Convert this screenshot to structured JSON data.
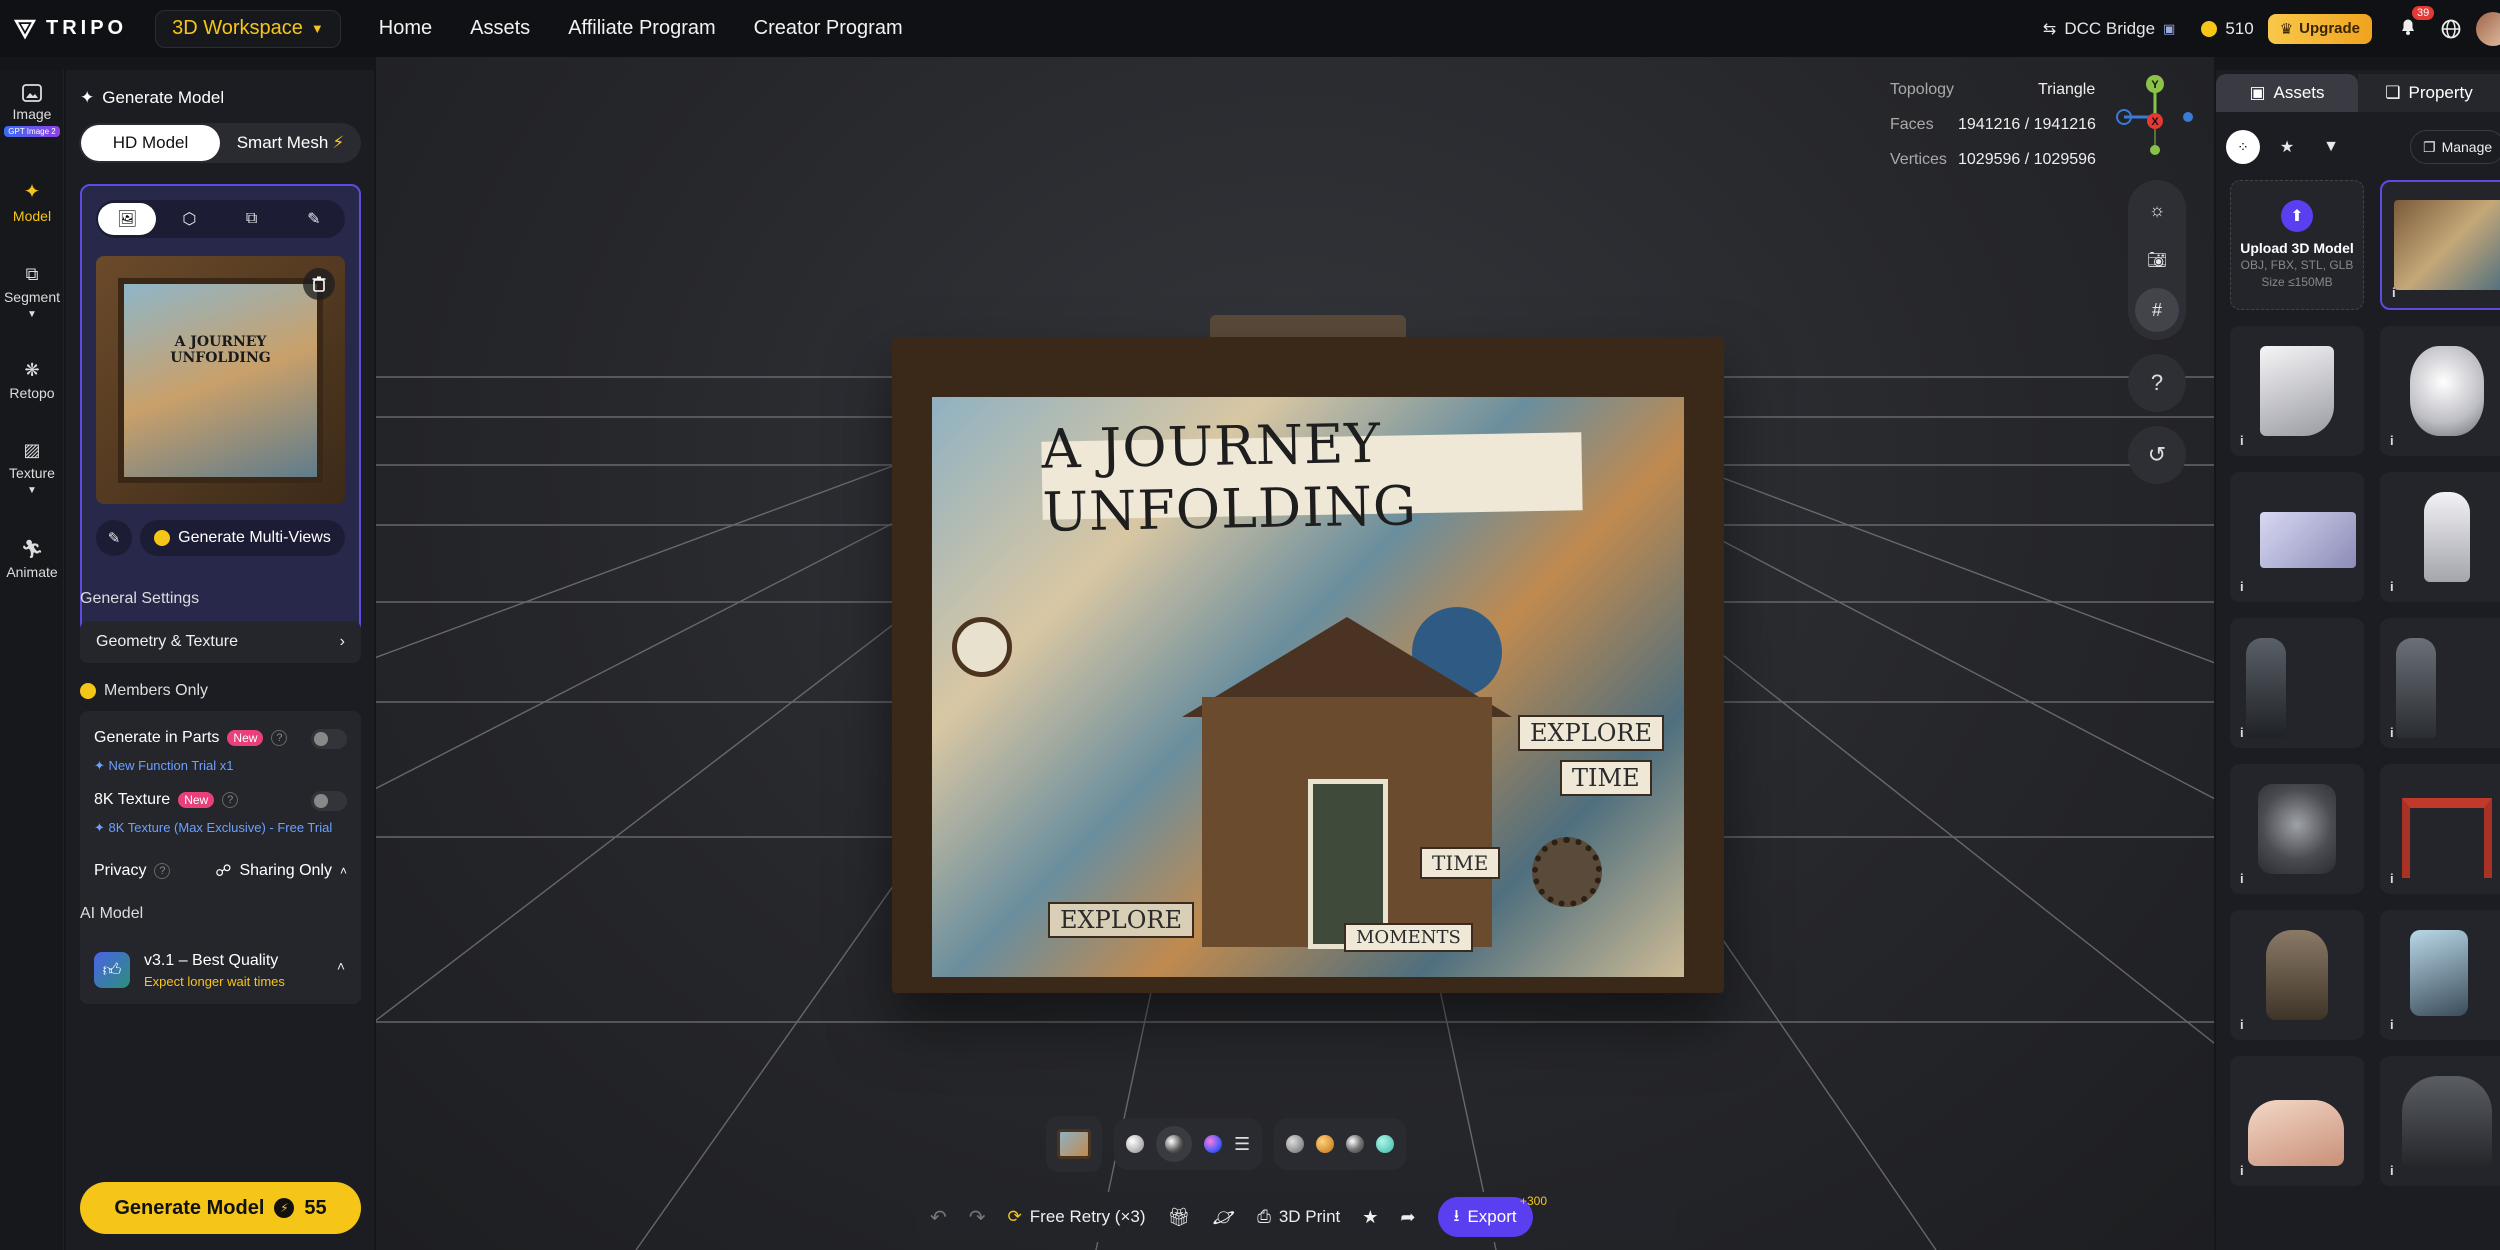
{
  "app": {
    "brand": "TRIPO",
    "workspace": "3D Workspace"
  },
  "nav": {
    "links": [
      "Home",
      "Assets",
      "Affiliate Program",
      "Creator Program"
    ]
  },
  "topright": {
    "dcc_bridge": "DCC Bridge",
    "credits": "510",
    "upgrade": "Upgrade",
    "notifications": "39"
  },
  "rail": {
    "items": [
      {
        "label": "Image",
        "badge": "GPT Image 2"
      },
      {
        "label": "Model"
      },
      {
        "label": "Segment"
      },
      {
        "label": "Retopo"
      },
      {
        "label": "Texture"
      },
      {
        "label": "Animate"
      }
    ]
  },
  "panel": {
    "title": "Generate Model",
    "mode_hd": "HD Model",
    "mode_smart": "Smart Mesh",
    "thumb_caption": "A JOURNEY UNFOLDING",
    "multiview": "Generate Multi-Views",
    "general_settings": "General Settings",
    "geometry_texture": "Geometry & Texture",
    "members_only": "Members Only",
    "parts_label": "Generate in Parts",
    "parts_new": "New",
    "parts_trial": "New Function Trial x1",
    "texture8k_label": "8K Texture",
    "texture8k_new": "New",
    "texture8k_trial": "8K Texture (Max Exclusive) - Free Trial",
    "privacy": "Privacy",
    "sharing": "Sharing Only",
    "ai_model_title": "AI Model",
    "ai_model_name": "v3.1 – Best Quality",
    "ai_model_note": "Expect longer wait times",
    "generate_button": "Generate Model",
    "generate_cost": "55"
  },
  "stats": {
    "topology_k": "Topology",
    "topology_v": "Triangle",
    "faces_k": "Faces",
    "faces_v": "1941216 / 1941216",
    "vertices_k": "Vertices",
    "vertices_v": "1029596 / 1029596"
  },
  "gizmo": {
    "y": "Y",
    "x": "X"
  },
  "viewport_tools": {
    "help": "?"
  },
  "model_art": {
    "banner": "A JOURNEY UNFOLDING",
    "label_explore": "EXPLORE",
    "label_time": "TIME",
    "label_time2": "TIME",
    "label_explore2": "EXPLORE",
    "label_moments": "MOMENTS"
  },
  "bottombar": {
    "free_retry": "Free Retry (×3)",
    "print": "3D Print",
    "plus300": "+300",
    "export": "Export"
  },
  "colors": {
    "accent_yellow": "#f5c518",
    "accent_purple": "#5a3ff0",
    "new_pink": "#e9407a",
    "link_blue": "#6aa0ff"
  },
  "rpanel": {
    "tab_assets": "Assets",
    "tab_property": "Property",
    "manage": "Manage",
    "upload_title": "Upload 3D Model",
    "upload_formats": "OBJ, FBX, STL, GLB",
    "upload_size": "Size ≤150MB",
    "info": "i"
  }
}
